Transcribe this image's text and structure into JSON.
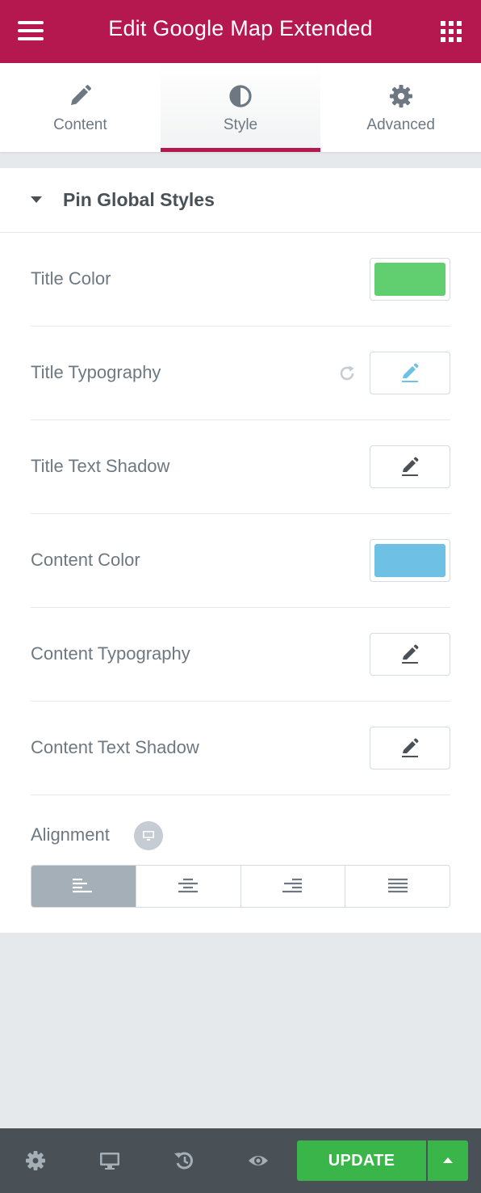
{
  "header": {
    "title": "Edit Google Map Extended",
    "menu_icon": "hamburger-icon",
    "apps_icon": "grid-icon"
  },
  "tabs": [
    {
      "label": "Content",
      "icon": "pencil-icon",
      "active": false
    },
    {
      "label": "Style",
      "icon": "half-circle-icon",
      "active": true
    },
    {
      "label": "Advanced",
      "icon": "gear-icon",
      "active": false
    }
  ],
  "section": {
    "title": "Pin Global Styles",
    "expanded": true
  },
  "controls": {
    "title_color": {
      "label": "Title Color",
      "value": "#61ce70"
    },
    "title_typography": {
      "label": "Title Typography",
      "edited": true
    },
    "title_text_shadow": {
      "label": "Title Text Shadow"
    },
    "content_color": {
      "label": "Content Color",
      "value": "#6ec1e4"
    },
    "content_typography": {
      "label": "Content Typography"
    },
    "content_text_shadow": {
      "label": "Content Text Shadow"
    },
    "alignment": {
      "label": "Alignment",
      "device_icon": "desktop-icon",
      "options": [
        "left",
        "center",
        "right",
        "justify"
      ],
      "selected": "left"
    }
  },
  "footer": {
    "update_label": "UPDATE",
    "icons": [
      "gear-icon",
      "desktop-icon",
      "history-icon",
      "eye-icon",
      "caret-up-icon"
    ]
  },
  "colors": {
    "brand": "#b5184f",
    "update": "#39b54a",
    "footer_bg": "#495157"
  }
}
